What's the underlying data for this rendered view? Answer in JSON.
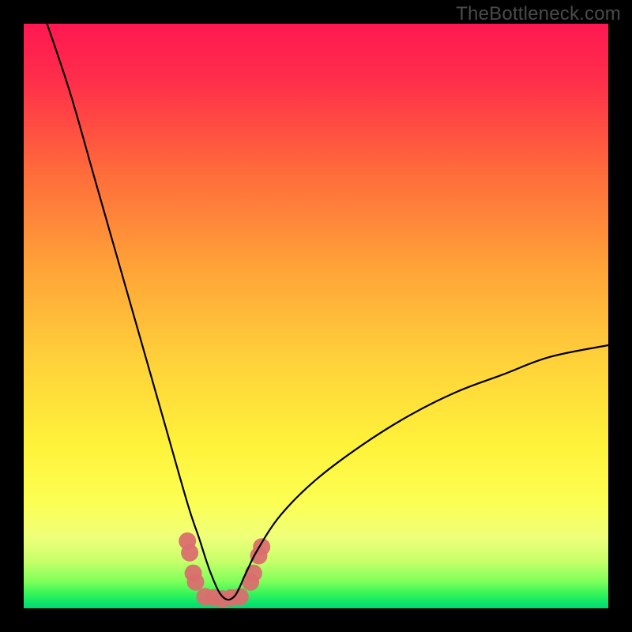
{
  "watermark": "TheBottleneck.com",
  "chart_data": {
    "type": "line",
    "title": "",
    "xlabel": "",
    "ylabel": "",
    "xlim": [
      0,
      100
    ],
    "ylim": [
      0,
      100
    ],
    "note": "Axes have no visible tick labels; values are estimated in relative 0–100 units. y=0 is the bottom green band, y=100 is the top.",
    "series": [
      {
        "name": "bottleneck-curve",
        "description": "V-shaped curve dipping to near-zero at ~34% x and rising toward ~45% y at the right edge. Minimum aligns with the ideal (green) zone.",
        "x": [
          4,
          8,
          12,
          16,
          20,
          24,
          28,
          30,
          32,
          34,
          36,
          38,
          40,
          44,
          50,
          58,
          66,
          74,
          82,
          90,
          100
        ],
        "y": [
          100,
          88,
          74,
          60,
          46,
          32,
          18,
          12,
          6,
          2,
          2,
          6,
          10,
          16,
          22,
          28,
          33,
          37,
          40,
          43,
          45
        ]
      }
    ],
    "markers": {
      "name": "highlighted-points",
      "description": "Cluster of chunky salmon markers near the curve minimum, along both sides of the V.",
      "color": "#d96f6e",
      "points": [
        {
          "x": 28.0,
          "y": 11.5
        },
        {
          "x": 28.4,
          "y": 9.5
        },
        {
          "x": 29.0,
          "y": 6.0
        },
        {
          "x": 29.4,
          "y": 4.5
        },
        {
          "x": 31.0,
          "y": 2.0
        },
        {
          "x": 32.5,
          "y": 1.8
        },
        {
          "x": 34.0,
          "y": 1.6
        },
        {
          "x": 35.5,
          "y": 1.8
        },
        {
          "x": 37.0,
          "y": 2.0
        },
        {
          "x": 38.8,
          "y": 4.5
        },
        {
          "x": 39.3,
          "y": 6.0
        },
        {
          "x": 40.2,
          "y": 9.0
        },
        {
          "x": 40.7,
          "y": 10.5
        }
      ]
    },
    "gradient": {
      "description": "Vertical background gradient inside the plot area matching bottleneck severity: red (bad) at top through orange/yellow to bright green (ideal) at the very bottom.",
      "stops": [
        {
          "offset": 0.0,
          "color": "#ff1851"
        },
        {
          "offset": 0.1,
          "color": "#ff2f4a"
        },
        {
          "offset": 0.25,
          "color": "#ff6a3b"
        },
        {
          "offset": 0.42,
          "color": "#ffa438"
        },
        {
          "offset": 0.58,
          "color": "#ffd23a"
        },
        {
          "offset": 0.72,
          "color": "#fff23a"
        },
        {
          "offset": 0.82,
          "color": "#fcff53"
        },
        {
          "offset": 0.88,
          "color": "#eeff7a"
        },
        {
          "offset": 0.92,
          "color": "#c6ff6a"
        },
        {
          "offset": 0.955,
          "color": "#7dff5a"
        },
        {
          "offset": 0.975,
          "color": "#34f55a"
        },
        {
          "offset": 0.99,
          "color": "#0ee66a"
        },
        {
          "offset": 1.0,
          "color": "#00d870"
        }
      ]
    }
  }
}
